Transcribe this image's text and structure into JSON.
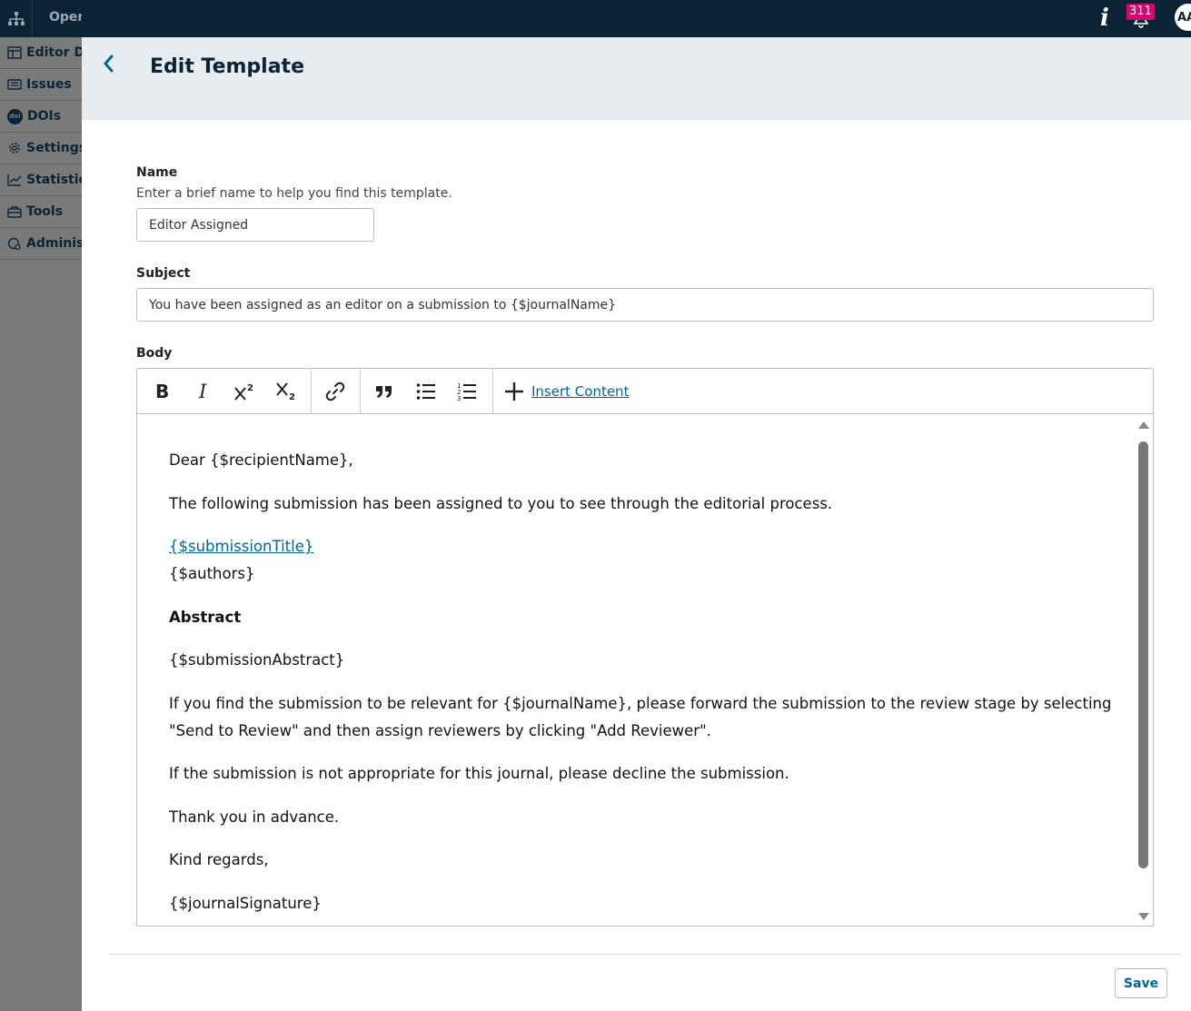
{
  "app": {
    "context_name": "Open Journal Systems",
    "sidebar": [
      {
        "label": "Editor Dashboard",
        "icon": "dashboard-icon"
      },
      {
        "label": "Issues",
        "icon": "issues-icon"
      },
      {
        "label": "DOIs",
        "icon": "doi-icon"
      },
      {
        "label": "Settings",
        "icon": "settings-icon"
      },
      {
        "label": "Statistics",
        "icon": "statistics-icon"
      },
      {
        "label": "Tools",
        "icon": "tools-icon"
      },
      {
        "label": "Administration",
        "icon": "administration-icon"
      }
    ]
  },
  "topbar": {
    "info_label": "i",
    "notification_count": "311",
    "avatar_initials": "AA"
  },
  "modal": {
    "title": "Edit Template"
  },
  "form": {
    "name": {
      "label": "Name",
      "description": "Enter a brief name to help you find this template.",
      "value": "Editor Assigned"
    },
    "subject": {
      "label": "Subject",
      "value": "You have been assigned as an editor on a submission to {$journalName}"
    },
    "body": {
      "label": "Body",
      "toolbar": {
        "insert_content_label": "Insert Content"
      },
      "paragraphs": {
        "greeting": "Dear {$recipientName},",
        "intro": "The following submission has been assigned to you to see through the editorial process.",
        "submission_title": "{$submissionTitle}",
        "authors": "{$authors}",
        "abstract_heading": "Abstract",
        "abstract": "{$submissionAbstract}",
        "relevance_line1": "If you find the submission to be relevant for {$journalName}, please forward the submission to the review stage by selecting",
        "relevance_line2": "\"Send to Review\" and then assign reviewers by clicking \"Add Reviewer\".",
        "decline": "If the submission is not appropriate for this journal, please decline the submission.",
        "thanks": "Thank you in advance.",
        "regards": "Kind regards,",
        "signature": "{$journalSignature}"
      }
    }
  },
  "actions": {
    "save_label": "Save"
  },
  "colors": {
    "topbar": "#0a2436",
    "accent": "#006798",
    "badge": "#d00a6c",
    "header_bg": "#e9ecee"
  }
}
